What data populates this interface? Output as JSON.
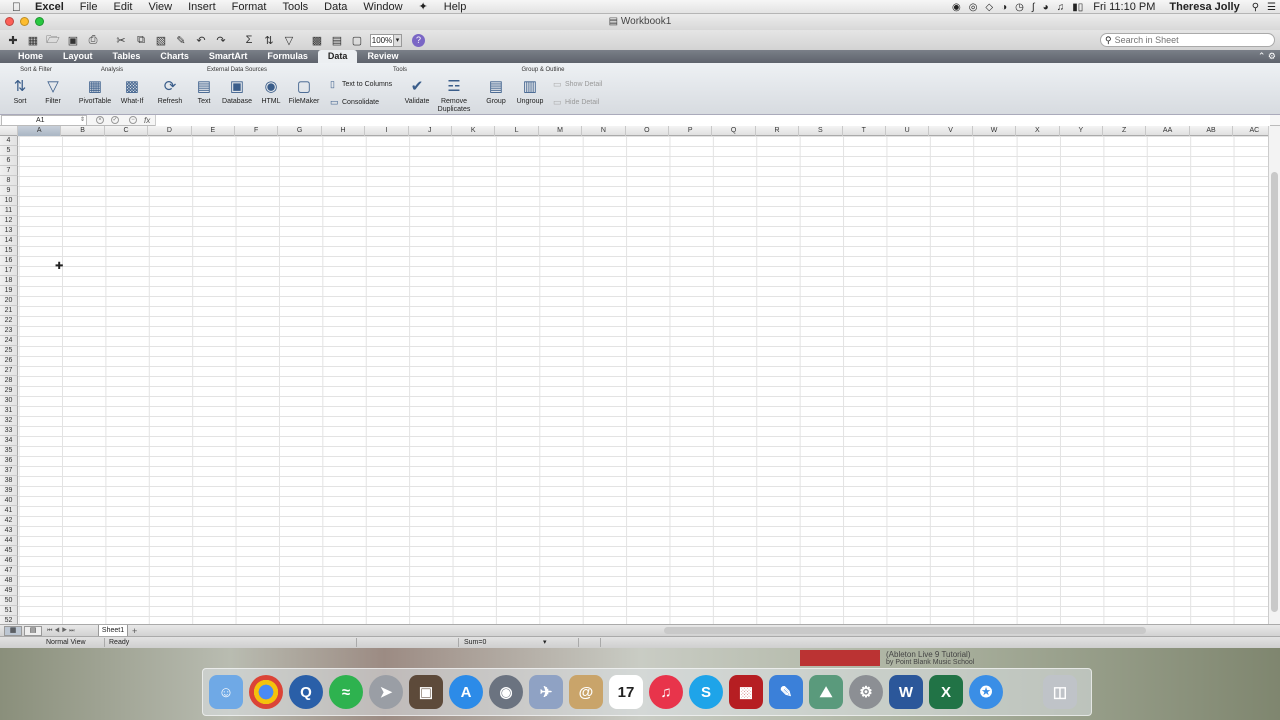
{
  "menubar": {
    "apple": "",
    "app_name": "Excel",
    "items": [
      "File",
      "Edit",
      "View",
      "Insert",
      "Format",
      "Tools",
      "Data",
      "Window",
      "",
      "Help"
    ],
    "clock": "Fri 11:10 PM",
    "user": "Theresa Jolly"
  },
  "window": {
    "title": "Workbook1"
  },
  "toolbar": {
    "zoom": "100%",
    "help": "?",
    "search_placeholder": "Search in Sheet"
  },
  "ribbon_tabs": [
    "Home",
    "Layout",
    "Tables",
    "Charts",
    "SmartArt",
    "Formulas",
    "Data",
    "Review"
  ],
  "active_tab": "Data",
  "ribbon": {
    "groups": {
      "sort_filter": "Sort & Filter",
      "analysis": "Analysis",
      "external": "External Data Sources",
      "tools": "Tools",
      "group_outline": "Group & Outline"
    },
    "buttons": {
      "sort": "Sort",
      "filter": "Filter",
      "pivot": "PivotTable",
      "whatif": "What-If",
      "refresh": "Refresh",
      "text": "Text",
      "database": "Database",
      "html": "HTML",
      "filemaker": "FileMaker",
      "text_to_columns": "Text to Columns",
      "consolidate": "Consolidate",
      "validate": "Validate",
      "remove_dup_1": "Remove",
      "remove_dup_2": "Duplicates",
      "group": "Group",
      "ungroup": "Ungroup",
      "show_detail": "Show Detail",
      "hide_detail": "Hide Detail"
    }
  },
  "formula_bar": {
    "name_box": "A1",
    "fx": "fx",
    "value": ""
  },
  "grid": {
    "columns": [
      "A",
      "B",
      "C",
      "D",
      "E",
      "F",
      "G",
      "H",
      "I",
      "J",
      "K",
      "L",
      "M",
      "N",
      "O",
      "P",
      "Q",
      "R",
      "S",
      "T",
      "U",
      "V",
      "W",
      "X",
      "Y",
      "Z",
      "AA",
      "AB",
      "AC"
    ],
    "selected_column": "A",
    "rows": [
      4,
      5,
      6,
      7,
      8,
      9,
      10,
      11,
      12,
      13,
      14,
      15,
      16,
      17,
      18,
      19,
      20,
      21,
      22,
      23,
      24,
      25,
      26,
      27,
      28,
      29,
      30,
      31,
      32,
      33,
      34,
      35,
      36,
      37,
      38,
      39,
      40,
      41,
      42,
      43,
      44,
      45,
      46,
      47,
      48,
      49,
      50,
      51,
      52
    ]
  },
  "sheets": [
    "Sheet1"
  ],
  "status": {
    "view": "Normal View",
    "state": "Ready",
    "sum": "Sum=0"
  },
  "desktop_clip": {
    "title": "(Ableton Live 9 Tutorial)",
    "by": "by Point Blank Music School"
  },
  "dock": {
    "calendar_day": "17",
    "apps": [
      "finder-icon",
      "chrome-icon",
      "quicktime-icon",
      "spotify-icon",
      "launchpad-icon",
      "photobooth-icon",
      "app-store-icon",
      "facetime-icon",
      "preview-icon",
      "mail-icon",
      "calendar-icon",
      "itunes-icon",
      "skype-icon",
      "photo-icon",
      "xcode-icon",
      "photos-icon",
      "system-preferences-icon",
      "word-icon",
      "excel-icon",
      "safari-icon",
      "trash-icon"
    ]
  }
}
